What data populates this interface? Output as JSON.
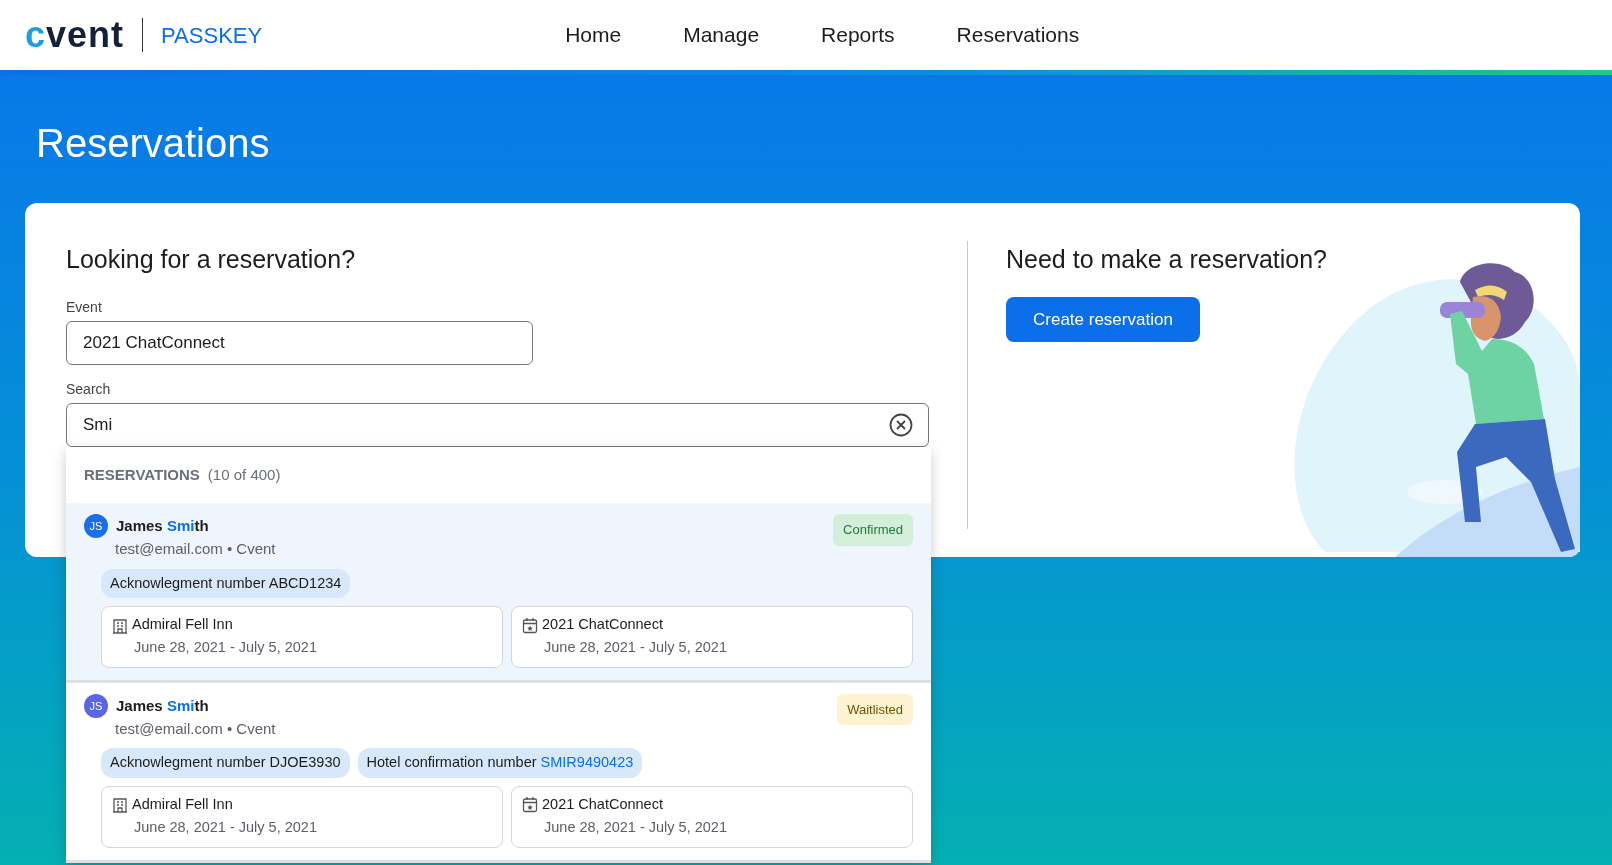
{
  "header": {
    "logo": "cvent",
    "product": "PASSKEY",
    "nav": [
      "Home",
      "Manage",
      "Reports",
      "Reservations"
    ]
  },
  "page_title": "Reservations",
  "find": {
    "heading": "Looking for a reservation?",
    "event": {
      "label": "Event",
      "value": "2021 ChatConnect"
    },
    "search": {
      "label": "Search",
      "value": "Smi"
    }
  },
  "create": {
    "heading": "Need to make a reservation?",
    "button": "Create reservation"
  },
  "results": {
    "title": "RESERVATIONS",
    "count": "(10 of 400)",
    "rows": [
      {
        "selected": true,
        "avatar": {
          "initials": "JS",
          "color": "#1a6fe8"
        },
        "name": "James **Smi**th",
        "subline": "test@email.com • Cvent",
        "status": {
          "label": "Confirmed",
          "kind": "confirmed"
        },
        "chips": [
          {
            "label": "Acknowlegment number",
            "value": "ABCD1234",
            "kind": "plain"
          }
        ],
        "details": [
          {
            "kind": "hotel",
            "title": "Admiral Fell Inn",
            "dates": "June 28, 2021 - July 5, 2021"
          },
          {
            "kind": "event",
            "title": "2021 ChatConnect",
            "dates": "June 28, 2021 - July 5, 2021"
          }
        ]
      },
      {
        "selected": false,
        "avatar": {
          "initials": "JS",
          "color": "#5b63e6"
        },
        "name": "James **Smi**th",
        "subline": "test@email.com • Cvent",
        "status": {
          "label": "Waitlisted",
          "kind": "waitlisted"
        },
        "chips": [
          {
            "label": "Acknowlegment number",
            "value": "DJOE3930",
            "kind": "plain"
          },
          {
            "label": "Hotel confirmation number",
            "value": "SMIR9490423",
            "kind": "link"
          }
        ],
        "details": [
          {
            "kind": "hotel",
            "title": "Admiral Fell Inn",
            "dates": "June 28, 2021 - July 5, 2021"
          },
          {
            "kind": "event",
            "title": "2021 ChatConnect",
            "dates": "June 28, 2021 - July 5, 2021"
          }
        ]
      }
    ]
  }
}
